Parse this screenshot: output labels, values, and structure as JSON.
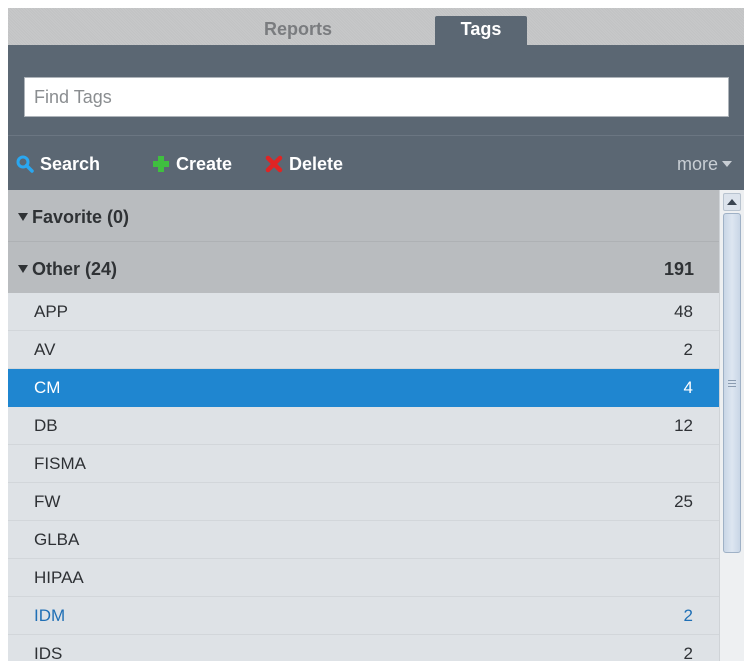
{
  "tabs": [
    {
      "label": "Reports"
    },
    {
      "label": "Tags"
    }
  ],
  "search": {
    "placeholder": "Find Tags",
    "value": ""
  },
  "toolbar": {
    "search_label": "Search",
    "create_label": "Create",
    "delete_label": "Delete",
    "more_label": "more"
  },
  "groups": [
    {
      "title": "Favorite (0)",
      "count": ""
    },
    {
      "title": "Other (24)",
      "count": "191"
    }
  ],
  "rows": [
    {
      "label": "APP",
      "count": "48"
    },
    {
      "label": "AV",
      "count": "2"
    },
    {
      "label": "CM",
      "count": "4"
    },
    {
      "label": "DB",
      "count": "12"
    },
    {
      "label": "FISMA",
      "count": ""
    },
    {
      "label": "FW",
      "count": "25"
    },
    {
      "label": "GLBA",
      "count": ""
    },
    {
      "label": "HIPAA",
      "count": ""
    },
    {
      "label": "IDM",
      "count": "2"
    },
    {
      "label": "IDS",
      "count": "2"
    }
  ],
  "icons": {
    "search": "magnifier-icon",
    "create": "plus-icon",
    "delete": "x-icon",
    "more": "caret-down-icon"
  },
  "colors": {
    "accent": "#1f86d0",
    "header": "#5b6773",
    "create": "#3fbf3f",
    "delete": "#e02424",
    "link": "#1f6fb5"
  }
}
